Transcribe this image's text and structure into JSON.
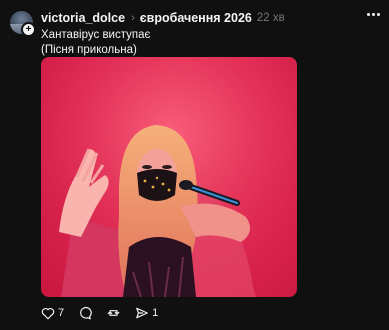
{
  "post": {
    "username": "victoria_dolce",
    "topic": "євробачення 2026",
    "time": "22 хв",
    "caption_line1": "Хантавірус виступає",
    "caption_line2": "(Пісня прикольна)",
    "media_icon": "concert-photo-image"
  },
  "actions": {
    "like_count": "7",
    "share_count": "1"
  },
  "icons": {
    "follow": "plus-icon",
    "more": "more-icon",
    "chevron": "chevron-right-icon",
    "like": "heart-icon",
    "comment": "comment-icon",
    "repost": "repost-icon",
    "share": "share-icon"
  },
  "colors": {
    "background": "#101010",
    "text": "#f3f5f7",
    "muted": "#777777",
    "stage_light": "#e32c55"
  }
}
